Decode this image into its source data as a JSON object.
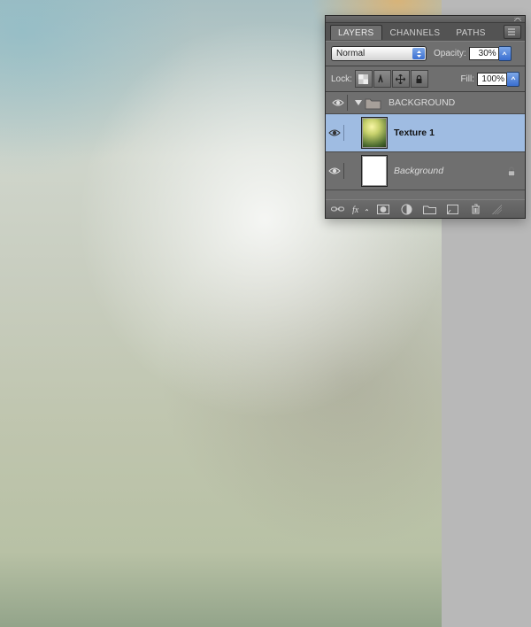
{
  "tabs": {
    "layers": "LAYERS",
    "channels": "CHANNELS",
    "paths": "PATHS"
  },
  "blend": {
    "mode": "Normal",
    "opacity_label": "Opacity:",
    "opacity_value": "30%",
    "fill_label": "Fill:",
    "fill_value": "100%",
    "lock_label": "Lock:"
  },
  "layers": {
    "group_name": "BACKGROUND",
    "texture_name": "Texture 1",
    "background_name": "Background"
  }
}
